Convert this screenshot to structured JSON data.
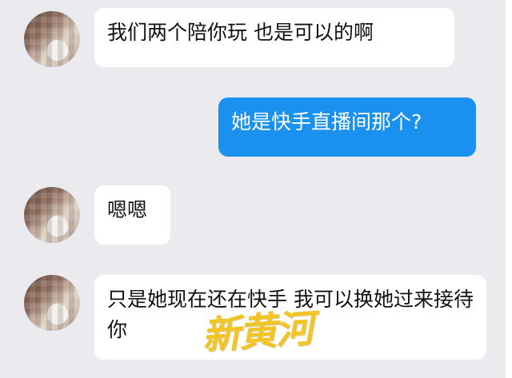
{
  "conversation": {
    "messages": [
      {
        "sender": "other",
        "text": "我们两个陪你玩 也是可以的啊"
      },
      {
        "sender": "me",
        "text": "她是快手直播间那个?"
      },
      {
        "sender": "other",
        "text": "嗯嗯"
      },
      {
        "sender": "other",
        "text": "只是她现在还在快手 我可以换她过来接待你"
      }
    ]
  },
  "watermark": {
    "text": "新黄河"
  },
  "colors": {
    "background": "#ebebef",
    "incoming_bubble": "#ffffff",
    "outgoing_bubble": "#1a91ef",
    "watermark": "#f1c21b"
  }
}
